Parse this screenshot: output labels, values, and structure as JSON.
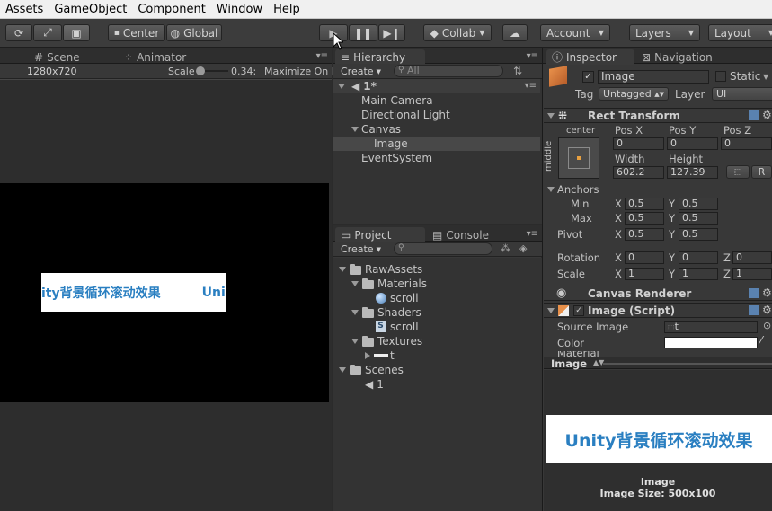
{
  "menu": [
    "Assets",
    "GameObject",
    "Component",
    "Window",
    "Help"
  ],
  "toolbar": {
    "center": "Center",
    "global": "Global",
    "collab": "Collab",
    "account": "Account",
    "layers": "Layers",
    "layout": "Layout"
  },
  "scene": {
    "tab_scene": "Scene",
    "tab_animator": "Animator",
    "resolution": "1280x720",
    "scale_label": "Scale",
    "scale_value": "0.34:",
    "maximize": "Maximize On P",
    "banner_text": "ity背景循环滚动效果",
    "banner_tail": "Uni"
  },
  "hierarchy": {
    "tab": "Hierarchy",
    "create": "Create",
    "search": "All",
    "scene_name": "1*",
    "items": [
      "Main Camera",
      "Directional Light",
      "Canvas",
      "Image",
      "EventSystem"
    ]
  },
  "project": {
    "tab_project": "Project",
    "tab_console": "Console",
    "create": "Create",
    "tree": [
      {
        "label": "RawAssets",
        "level": 0,
        "type": "folder"
      },
      {
        "label": "Materials",
        "level": 1,
        "type": "folder"
      },
      {
        "label": "scroll",
        "level": 2,
        "type": "material"
      },
      {
        "label": "Shaders",
        "level": 1,
        "type": "folder"
      },
      {
        "label": "scroll",
        "level": 2,
        "type": "shader"
      },
      {
        "label": "Textures",
        "level": 1,
        "type": "folder"
      },
      {
        "label": "t",
        "level": 2,
        "type": "texture"
      },
      {
        "label": "Scenes",
        "level": 0,
        "type": "folder"
      },
      {
        "label": "1",
        "level": 1,
        "type": "scene"
      }
    ]
  },
  "inspector": {
    "tab": "Inspector",
    "tab_nav": "Navigation",
    "object_name": "Image",
    "static": "Static",
    "tag_label": "Tag",
    "tag_value": "Untagged",
    "layer_label": "Layer",
    "layer_value": "UI",
    "rect": {
      "title": "Rect Transform",
      "anchor_h": "center",
      "anchor_v": "middle",
      "pos_x_label": "Pos X",
      "pos_y_label": "Pos Y",
      "pos_z_label": "Pos Z",
      "pos_x": "0",
      "pos_y": "0",
      "pos_z": "0",
      "width_label": "Width",
      "height_label": "Height",
      "width": "602.2",
      "height": "127.39",
      "r_btn": "R",
      "anchors_label": "Anchors",
      "min_label": "Min",
      "max_label": "Max",
      "pivot_label": "Pivot",
      "min_x": "0.5",
      "min_y": "0.5",
      "max_x": "0.5",
      "max_y": "0.5",
      "pivot_x": "0.5",
      "pivot_y": "0.5",
      "rotation_label": "Rotation",
      "rot_x": "0",
      "rot_y": "0",
      "rot_z": "0",
      "scale_label": "Scale",
      "scale_x": "1",
      "scale_y": "1",
      "scale_z": "1",
      "x": "X",
      "y": "Y",
      "z": "Z"
    },
    "canvas_renderer": "Canvas Renderer",
    "image_script": "Image (Script)",
    "source_image_label": "Source Image",
    "source_image": "t",
    "color_label": "Color",
    "material_label": "Material"
  },
  "preview": {
    "title": "Image",
    "banner": "Unity背景循环滚动效果",
    "caption": "Image",
    "size": "Image Size: 500x100"
  }
}
